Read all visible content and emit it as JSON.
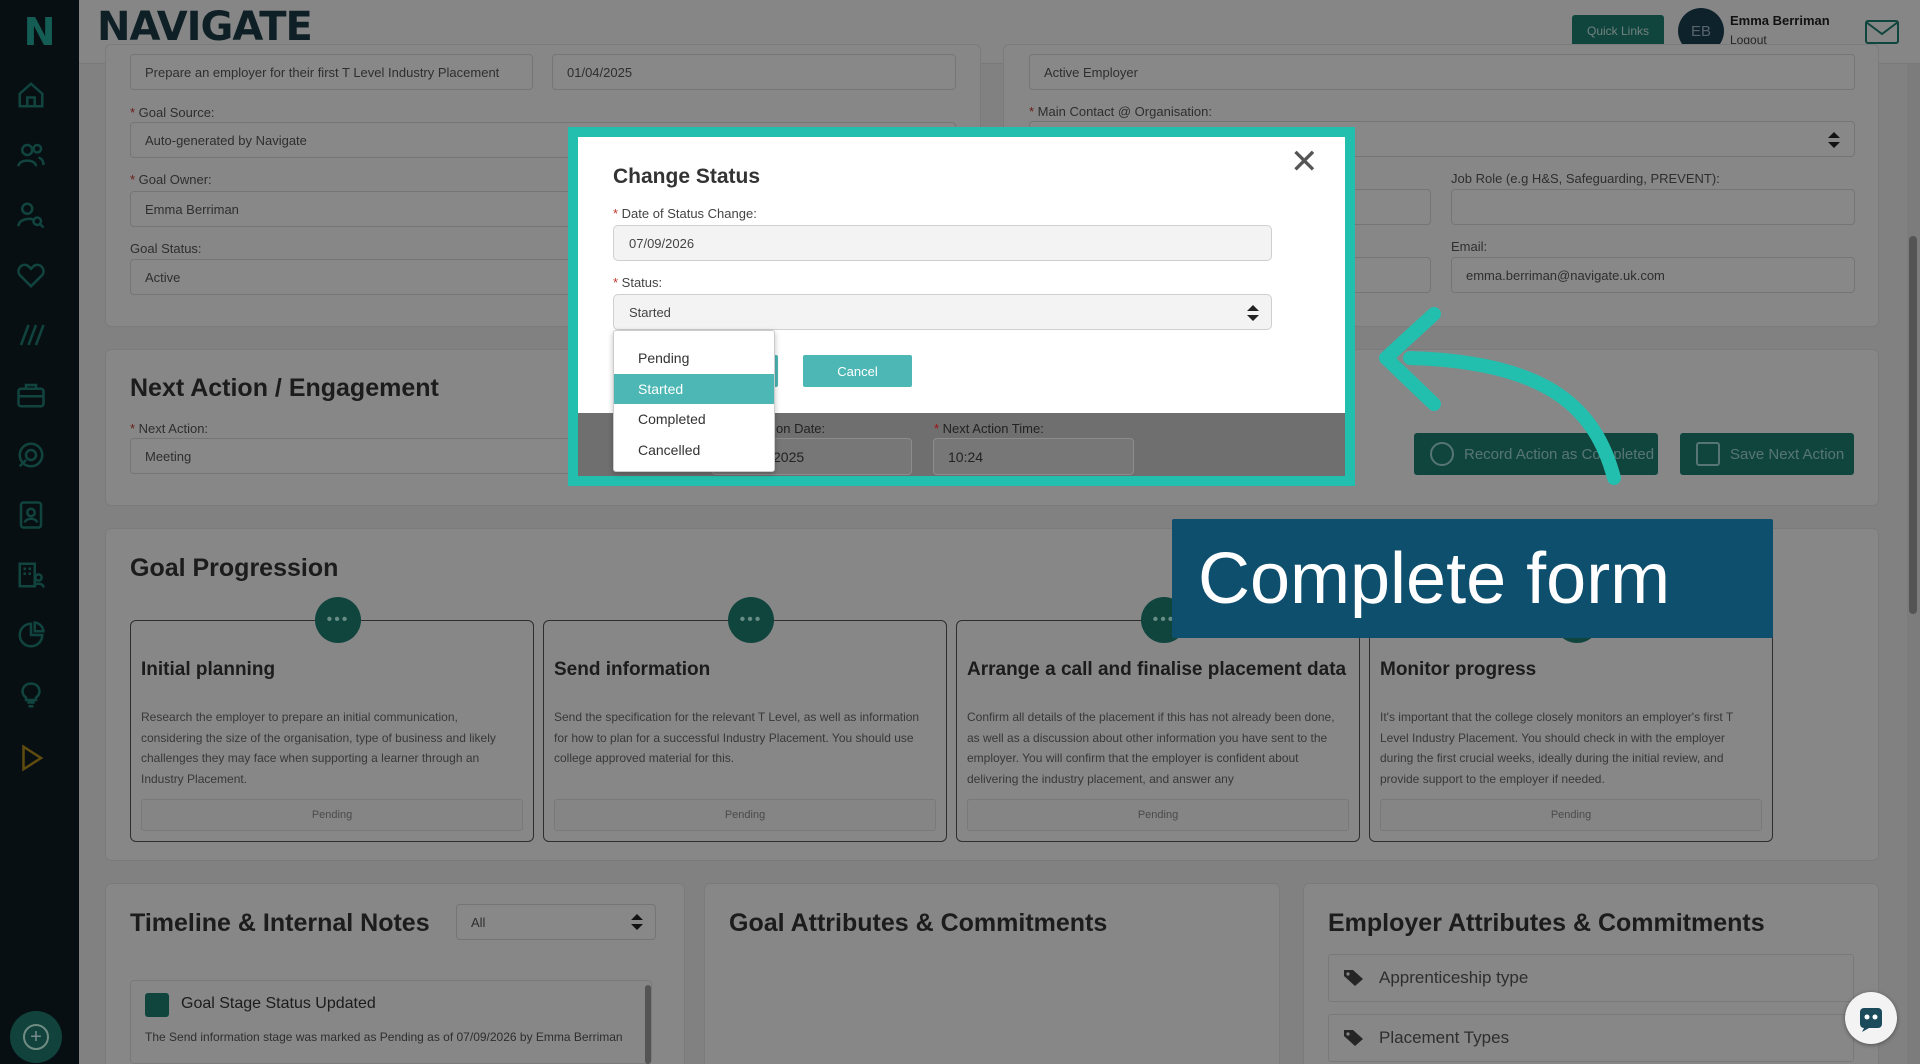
{
  "brand": {
    "name": "NAVIGATE",
    "logo_letter": "N"
  },
  "header": {
    "quick_links": "Quick Links",
    "avatar_initials": "EB",
    "user_name": "Emma Berriman",
    "logout": "Logout"
  },
  "sidebar": {
    "icons": [
      "home-icon",
      "users-icon",
      "user-search-icon",
      "heart-icon",
      "stages-icon",
      "briefcase-icon",
      "support-icon",
      "contact-book-icon",
      "building-users-icon",
      "chart-pie-icon",
      "lightbulb-icon",
      "play-icon",
      "add-circle-icon"
    ]
  },
  "goal_details": {
    "goal_name_value": "Prepare an employer for their first T Level Industry Placement",
    "goal_date_value": "01/04/2025",
    "goal_source_label": "Goal Source:",
    "goal_source_value": "Auto-generated by Navigate",
    "goal_owner_label": "Goal Owner:",
    "goal_owner_value": "Emma Berriman",
    "goal_status_label": "Goal Status:",
    "goal_status_value": "Active"
  },
  "employer_details": {
    "employer_status_value": "Active Employer",
    "main_contact_label": "Main Contact @ Organisation:",
    "job_role_label": "Job Role (e.g H&S, Safeguarding, PREVENT):",
    "email_label": "Email:",
    "email_value": "emma.berriman@navigate.uk.com"
  },
  "next_action": {
    "title": "Next Action / Engagement",
    "next_action_label": "Next Action:",
    "next_action_value": "Meeting",
    "next_action_date_label": "on Date:",
    "next_action_date_value": "2025",
    "next_action_time_label": "Next Action Time:",
    "next_action_time_value": "10:24",
    "record_button": "Record Action as Completed",
    "save_button": "Save Next Action"
  },
  "goal_progression": {
    "title": "Goal Progression",
    "stages": [
      {
        "title": "Initial planning",
        "description": "Research the employer to prepare an initial communication, considering the size of the organisation, type of business and likely challenges they may face when supporting a learner through an Industry Placement.",
        "status": "Pending"
      },
      {
        "title": "Send information",
        "description": "Send the specification for the relevant T Level, as well as information for how to plan for a successful Industry Placement. You should use college approved material for this.",
        "status": "Pending"
      },
      {
        "title": "Arrange a call and finalise placement data",
        "description": "Confirm all details of the placement if this has not already been done, as well as a discussion about other information you have sent to the employer. You will confirm that the employer is confident about delivering the industry placement, and answer any",
        "status": "Pending"
      },
      {
        "title": "Monitor progress",
        "description": "It's important that the college closely monitors an employer's first T Level Industry Placement. You should check in with the employer during the first crucial weeks, ideally during the initial review, and provide support to the employer if needed.",
        "status": "Pending"
      }
    ]
  },
  "timeline": {
    "title": "Timeline & Internal Notes",
    "filter_value": "All",
    "item_title": "Goal Stage Status Updated",
    "item_text": "The Send information stage was marked as Pending as of 07/09/2026 by Emma Berriman"
  },
  "goal_attributes": {
    "title": "Goal Attributes & Commitments"
  },
  "employer_attributes": {
    "title": "Employer Attributes & Commitments",
    "items": [
      "Apprenticeship type",
      "Placement Types"
    ]
  },
  "modal": {
    "title": "Change Status",
    "close_symbol": "✕",
    "date_label": "Date of Status Change:",
    "date_value": "07/09/2026",
    "status_label": "Status:",
    "status_value": "Started",
    "cancel_button": "Cancel",
    "status_options": [
      "Pending",
      "Started",
      "Completed",
      "Cancelled"
    ],
    "selected_option": "Started"
  },
  "annotation": {
    "callout_text": "Complete form"
  },
  "colors": {
    "brand_teal": "#1e7e72",
    "highlight_teal": "#23bfae",
    "callout_blue": "#0f4f6e",
    "option_selected": "#4cb7b4"
  }
}
